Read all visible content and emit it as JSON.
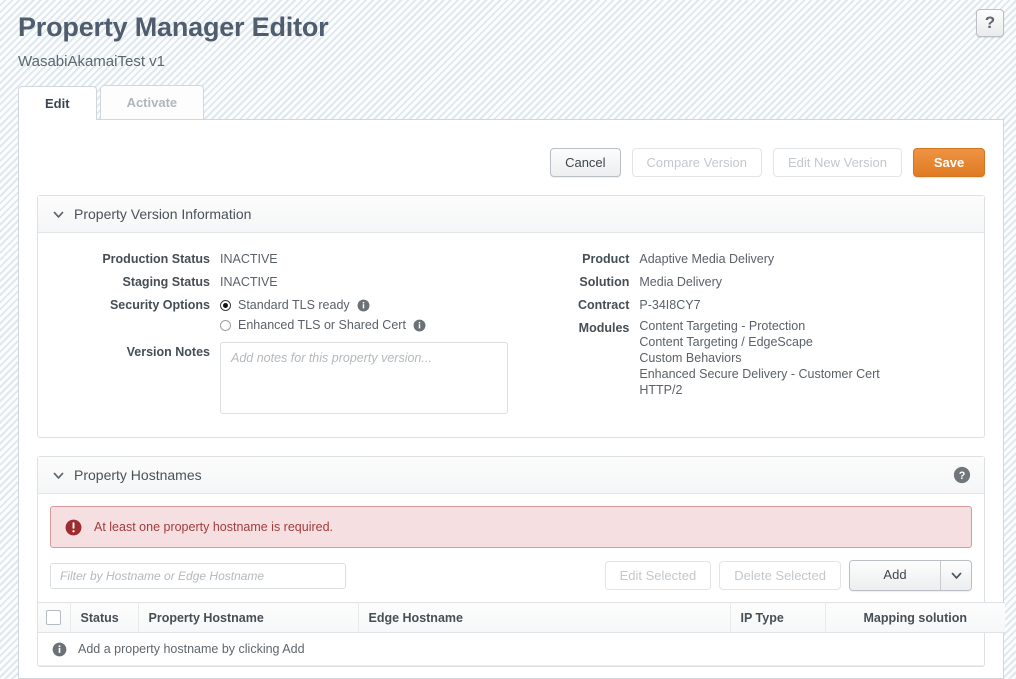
{
  "header": {
    "title": "Property Manager Editor",
    "subtitle": "WasabiAkamaiTest v1",
    "help_button_label": "?",
    "help_icon": "question-mark-icon"
  },
  "tabs": [
    {
      "label": "Edit",
      "active": true
    },
    {
      "label": "Activate",
      "active": false
    }
  ],
  "toolbar": {
    "cancel_label": "Cancel",
    "compare_version_label": "Compare Version",
    "edit_new_version_label": "Edit New Version",
    "save_label": "Save",
    "save_color": "#e07b23"
  },
  "version_panel": {
    "title": "Property Version Information",
    "collapse_icon": "chevron-down-icon",
    "left": {
      "production_status_label": "Production Status",
      "production_status_value": "INACTIVE",
      "staging_status_label": "Staging Status",
      "staging_status_value": "INACTIVE",
      "security_options_label": "Security Options",
      "security_options": [
        {
          "label": "Standard TLS ready",
          "selected": true,
          "info_icon": "info-icon"
        },
        {
          "label": "Enhanced TLS or Shared Cert",
          "selected": false,
          "info_icon": "info-icon"
        }
      ],
      "version_notes_label": "Version Notes",
      "version_notes_placeholder": "Add notes for this property version...",
      "version_notes_value": ""
    },
    "right": {
      "product_label": "Product",
      "product_value": "Adaptive Media Delivery",
      "solution_label": "Solution",
      "solution_value": "Media Delivery",
      "contract_label": "Contract",
      "contract_value": "P-34I8CY7",
      "modules_label": "Modules",
      "modules_values": [
        "Content Targeting - Protection",
        "Content Targeting / EdgeScape",
        "Custom Behaviors",
        "Enhanced Secure Delivery - Customer Cert",
        "HTTP/2"
      ]
    }
  },
  "hostnames_panel": {
    "title": "Property Hostnames",
    "collapse_icon": "chevron-down-icon",
    "help_icon": "help-circle-icon",
    "error": {
      "icon": "error-exclamation-icon",
      "message": "At least one property hostname is required.",
      "color": "#a23d3f",
      "background": "#f5dfe0"
    },
    "filter_placeholder": "Filter by Hostname or Edge Hostname",
    "filter_value": "",
    "edit_selected_label": "Edit Selected",
    "delete_selected_label": "Delete Selected",
    "add_label": "Add",
    "add_dropdown_icon": "chevron-down-icon",
    "table": {
      "select_all_checkbox": "select-all-checkbox",
      "columns": [
        "Status",
        "Property Hostname",
        "Edge Hostname",
        "IP Type",
        "Mapping solution"
      ],
      "rows": [],
      "empty_icon": "info-icon",
      "empty_message": "Add a property hostname by clicking Add"
    }
  }
}
